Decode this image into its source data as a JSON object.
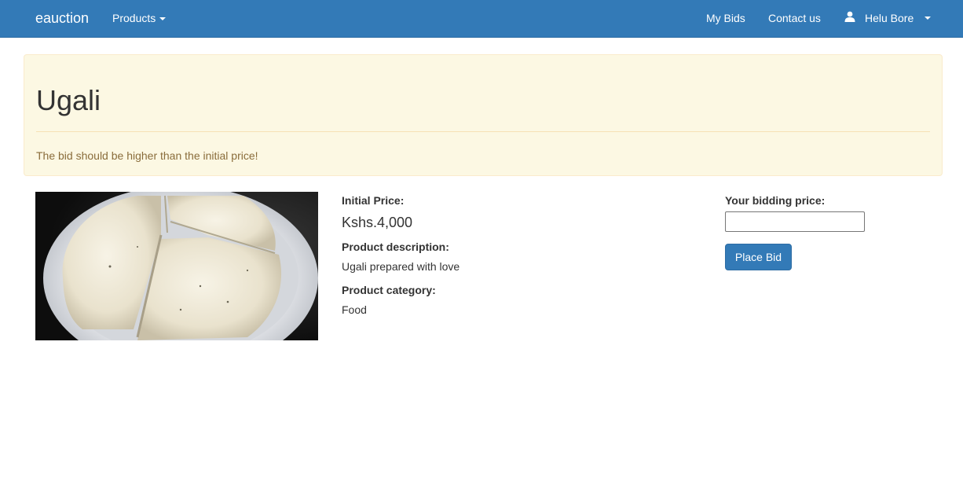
{
  "navbar": {
    "brand": "eauction",
    "products_label": "Products",
    "my_bids_label": "My Bids",
    "contact_label": "Contact us",
    "user_name": "Helu Bore"
  },
  "alert": {
    "title": "Ugali",
    "message": "The bid should be higher than the initial price!"
  },
  "product": {
    "image_icon": "ugali-photo",
    "initial_price_label": "Initial Price:",
    "initial_price": "Kshs.4,000",
    "description_label": "Product description:",
    "description": "Ugali prepared with love",
    "category_label": "Product category:",
    "category": "Food"
  },
  "bid": {
    "label": "Your bidding price:",
    "input_value": "",
    "button_label": "Place Bid"
  },
  "colors": {
    "primary": "#337ab7",
    "alert_bg": "#fcf8e3",
    "alert_text": "#8a6d3b"
  }
}
